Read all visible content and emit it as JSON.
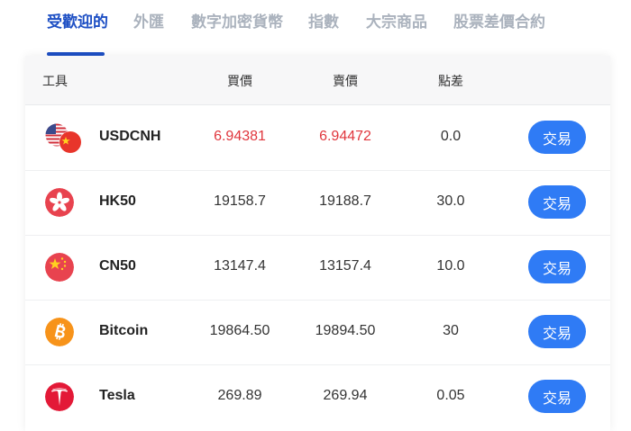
{
  "tabs": [
    {
      "label": "受歡迎的",
      "active": true
    },
    {
      "label": "外匯"
    },
    {
      "label": "數字加密貨幣"
    },
    {
      "label": "指數"
    },
    {
      "label": "大宗商品"
    },
    {
      "label": "股票差價合約"
    }
  ],
  "table": {
    "headers": {
      "instrument": "工具",
      "bid": "買價",
      "ask": "賣價",
      "spread": "點差"
    },
    "rows": [
      {
        "name": "USDCNH",
        "bid": "6.94381",
        "ask": "6.94472",
        "spread": "0.0",
        "trade": "交易",
        "icon": "us-cn-flags-icon",
        "price_color": "#e0363d"
      },
      {
        "name": "HK50",
        "bid": "19158.7",
        "ask": "19188.7",
        "spread": "30.0",
        "trade": "交易",
        "icon": "hong-kong-flag-icon"
      },
      {
        "name": "CN50",
        "bid": "13147.4",
        "ask": "13157.4",
        "spread": "10.0",
        "trade": "交易",
        "icon": "china-flag-icon"
      },
      {
        "name": "Bitcoin",
        "bid": "19864.50",
        "ask": "19894.50",
        "spread": "30",
        "trade": "交易",
        "icon": "bitcoin-icon"
      },
      {
        "name": "Tesla",
        "bid": "269.89",
        "ask": "269.94",
        "spread": "0.05",
        "trade": "交易",
        "icon": "tesla-logo-icon"
      }
    ]
  },
  "colors": {
    "accent": "#1d4fc4",
    "button": "#2f7bf5",
    "price_up": "#e0363d",
    "tab_inactive": "#aab2bd"
  }
}
